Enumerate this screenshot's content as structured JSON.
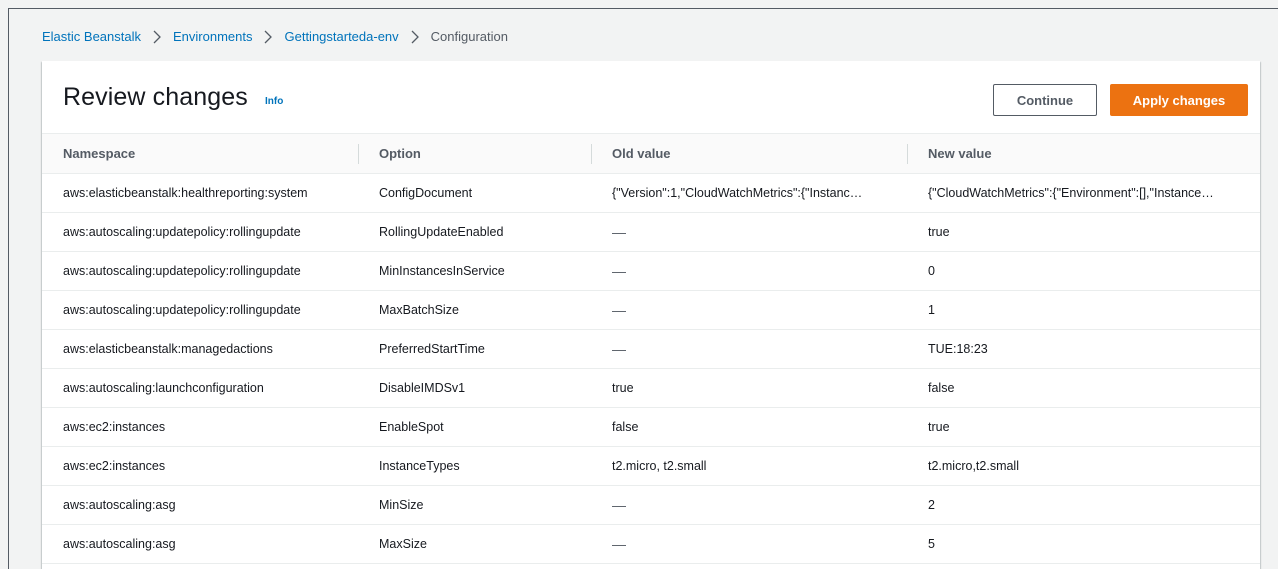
{
  "breadcrumb": {
    "items": [
      "Elastic Beanstalk",
      "Environments",
      "Gettingstarteda-env"
    ],
    "current": "Configuration"
  },
  "header": {
    "title": "Review changes",
    "info": "Info",
    "continue_label": "Continue",
    "apply_label": "Apply changes"
  },
  "table": {
    "columns": [
      "Namespace",
      "Option",
      "Old value",
      "New value"
    ],
    "rows": [
      [
        "aws:elasticbeanstalk:healthreporting:system",
        "ConfigDocument",
        "{\"Version\":1,\"CloudWatchMetrics\":{\"Instanc…",
        "{\"CloudWatchMetrics\":{\"Environment\":[],\"Instance…"
      ],
      [
        "aws:autoscaling:updatepolicy:rollingupdate",
        "RollingUpdateEnabled",
        "—",
        "true"
      ],
      [
        "aws:autoscaling:updatepolicy:rollingupdate",
        "MinInstancesInService",
        "—",
        "0"
      ],
      [
        "aws:autoscaling:updatepolicy:rollingupdate",
        "MaxBatchSize",
        "—",
        "1"
      ],
      [
        "aws:elasticbeanstalk:managedactions",
        "PreferredStartTime",
        "—",
        "TUE:18:23"
      ],
      [
        "aws:autoscaling:launchconfiguration",
        "DisableIMDSv1",
        "true",
        "false"
      ],
      [
        "aws:ec2:instances",
        "EnableSpot",
        "false",
        "true"
      ],
      [
        "aws:ec2:instances",
        "InstanceTypes",
        "t2.micro, t2.small",
        "t2.micro,t2.small"
      ],
      [
        "aws:autoscaling:asg",
        "MinSize",
        "—",
        "2"
      ],
      [
        "aws:autoscaling:asg",
        "MaxSize",
        "—",
        "5"
      ]
    ]
  }
}
